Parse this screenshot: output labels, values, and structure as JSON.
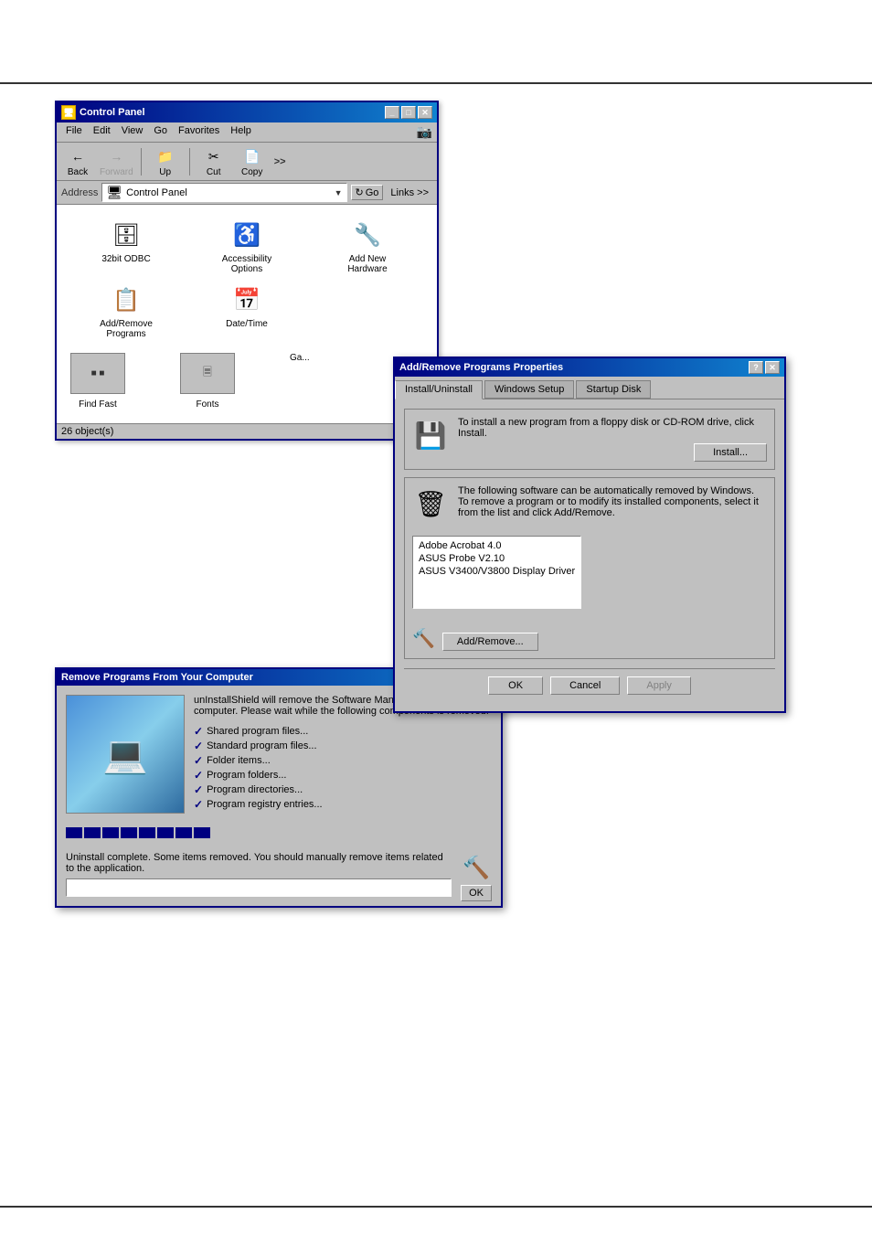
{
  "page": {
    "top_rule_color": "#333333",
    "bottom_rule_color": "#333333"
  },
  "control_panel": {
    "title": "Control Panel",
    "titlebar_icon": "🖥",
    "menu_items": [
      "File",
      "Edit",
      "View",
      "Go",
      "Favorites",
      "Help"
    ],
    "toolbar": {
      "back_label": "Back",
      "forward_label": "Forward",
      "up_label": "Up",
      "cut_label": "Cut",
      "copy_label": "Copy",
      "more_label": ">>"
    },
    "address": {
      "label": "Address",
      "value": "Control Panel",
      "go_label": "Go",
      "links_label": "Links >>"
    },
    "icons": [
      {
        "label": "32bit ODBC",
        "emoji": "🗄"
      },
      {
        "label": "Accessibility Options",
        "emoji": "♿"
      },
      {
        "label": "Add New Hardware",
        "emoji": "🔧"
      },
      {
        "label": "Add/Remove Programs",
        "emoji": "📋"
      },
      {
        "label": "Date/Time",
        "emoji": "📅"
      }
    ],
    "row2_icons": [
      {
        "label": "Find Fast",
        "emoji": "🔍"
      },
      {
        "label": "Fonts",
        "emoji": "Aa"
      },
      {
        "label": "Ga...",
        "emoji": "🎮"
      }
    ],
    "statusbar": "26 object(s)",
    "window_btns": {
      "minimize": "_",
      "maximize": "□",
      "close": "✕"
    }
  },
  "addremove_props": {
    "title": "Add/Remove Programs Properties",
    "tabs": [
      {
        "label": "Install/Uninstall",
        "active": true
      },
      {
        "label": "Windows Setup",
        "active": false
      },
      {
        "label": "Startup Disk",
        "active": false
      }
    ],
    "install_section": {
      "text": "To install a new program from a floppy disk or CD-ROM drive, click Install.",
      "button_label": "Install..."
    },
    "software_section": {
      "text": "The following software can be automatically removed by Windows. To remove a program or to modify its installed components, select it from the list and click Add/Remove.",
      "items": [
        "Adobe Acrobat 4.0",
        "ASUS Probe V2.10",
        "ASUS V3400/V3800 Display Driver"
      ],
      "button_label": "Add/Remove..."
    },
    "footer_buttons": [
      {
        "label": "OK"
      },
      {
        "label": "Cancel"
      },
      {
        "label": "Apply",
        "disabled": true
      }
    ],
    "window_btns": {
      "help": "?",
      "close": "✕"
    }
  },
  "remove_programs": {
    "title": "Remove Programs From Your Computer",
    "main_text": "unInstallShield will remove the Software Manager from your computer. Please wait while the following components is removed:",
    "checklist": [
      "Shared program files...",
      "Standard program files...",
      "Folder items...",
      "Program folders...",
      "Program directories...",
      "Program registry entries..."
    ],
    "progress_blocks": 8,
    "complete_text": "Uninstall complete. Some items removed. You should manually remove items related to the application.",
    "ok_button_label": "OK"
  }
}
